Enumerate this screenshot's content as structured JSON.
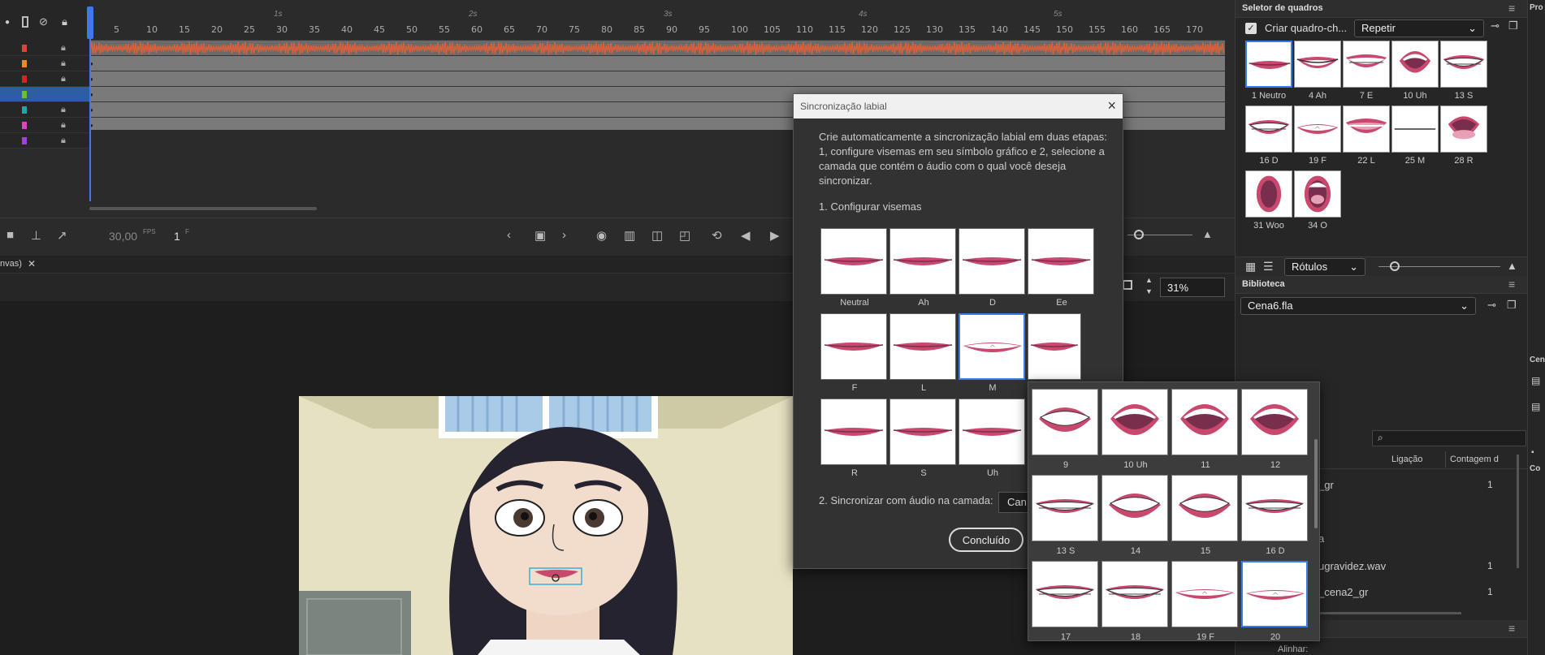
{
  "timeline": {
    "seconds": [
      "1s",
      "2s",
      "3s",
      "4s",
      "5s"
    ],
    "ticks": [
      "5",
      "10",
      "15",
      "20",
      "25",
      "30",
      "35",
      "40",
      "45",
      "50",
      "55",
      "60",
      "65",
      "70",
      "75",
      "80",
      "85",
      "90",
      "95",
      "100",
      "105",
      "110",
      "115",
      "120",
      "125",
      "130",
      "135",
      "140",
      "145",
      "150",
      "155",
      "160",
      "165",
      "170"
    ],
    "layer_colors": [
      "#e0403a",
      "#f08a1a",
      "#e02020",
      "#6abf2a",
      "#1aa8a8",
      "#e040d0",
      "#a040e0"
    ],
    "fps": "30,00",
    "fps_unit": "FPS",
    "frame": "1",
    "frame_unit": "F",
    "audio_color": "#d9603a"
  },
  "stage": {
    "tab_label": "nvas)",
    "zoom": "31%"
  },
  "frame_picker": {
    "title": "Seletor de quadros",
    "create_keyframe": "Criar quadro-ch...",
    "loop_mode": "Repetir",
    "labels_mode": "Rótulos",
    "frames": [
      "1 Neutro",
      "4 Ah",
      "7 E",
      "10 Uh",
      "13 S",
      "16 D",
      "19 F",
      "22 L",
      "25 M",
      "28 R",
      "31 Woo",
      "34 O"
    ]
  },
  "library": {
    "title": "Biblioteca",
    "file": "Cena6.fla",
    "col_link": "Ligação",
    "col_count": "Contagem d",
    "items": [
      {
        "name": "_gr",
        "count": "1"
      },
      {
        "name": "a",
        "count": ""
      },
      {
        "name": "ugravidez.wav",
        "count": "1"
      },
      {
        "name": "_cena2_gr",
        "count": "1"
      }
    ],
    "align_label": "Alinhar:",
    "side_label1": "Cen",
    "side_label2": "Co"
  },
  "properties_tab": "Pro",
  "dialog": {
    "title": "Sincronização labial",
    "intro": "Crie automaticamente a sincronização labial em duas etapas: 1, configure visemas em seu símbolo gráfico e 2, selecione a camada que contém o áudio com o qual você deseja sincronizar.",
    "step1": "1. Configurar visemas",
    "visemes": [
      "Neutral",
      "Ah",
      "D",
      "Ee",
      "F",
      "L",
      "M",
      "",
      "R",
      "S",
      "Uh",
      ""
    ],
    "step2": "2. Sincronizar com áudio na camada:",
    "layer_value": "Can",
    "done": "Concluído"
  },
  "popup": {
    "frames": [
      "9",
      "10 Uh",
      "11",
      "12",
      "13 S",
      "14",
      "15",
      "16 D",
      "17",
      "18",
      "19 F",
      "20"
    ]
  }
}
